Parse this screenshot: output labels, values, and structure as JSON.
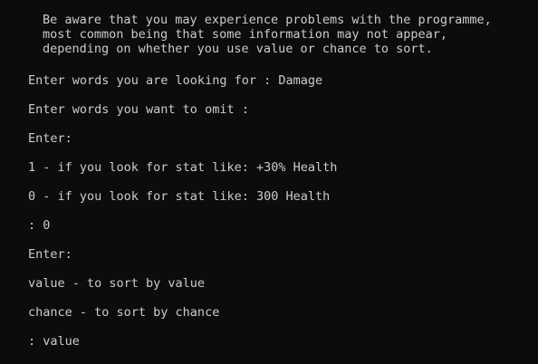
{
  "warning": {
    "line1": "Be aware that you may experience problems with the programme,",
    "line2": "most common being that some information may not appear,",
    "line3": "depending on whether you use value or chance to sort."
  },
  "prompts": {
    "words_looking_for": "Enter words you are looking for : ",
    "words_looking_for_value": "Damage",
    "words_omit": "Enter words you want to omit : ",
    "words_omit_value": "",
    "enter1": "Enter:",
    "option_percent": "1 - if you look for stat like: +30% Health",
    "option_flat": "0 - if you look for stat like: 300 Health",
    "stat_prompt": ": ",
    "stat_value": "0",
    "enter2": "Enter:",
    "sort_value": "value - to sort by value",
    "sort_chance": "chance - to sort by chance",
    "sort_prompt": ": ",
    "sort_input": "value"
  }
}
